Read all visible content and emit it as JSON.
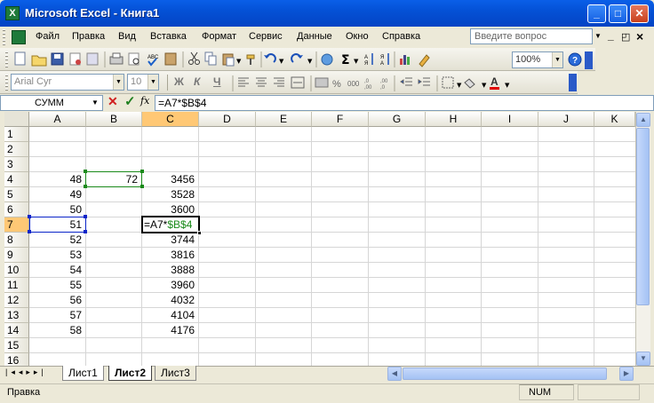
{
  "window": {
    "title": "Microsoft Excel - Книга1",
    "app_icon": "X",
    "min": "_",
    "max": "□",
    "close": "✕"
  },
  "menu": {
    "items": [
      "Файл",
      "Правка",
      "Вид",
      "Вставка",
      "Формат",
      "Сервис",
      "Данные",
      "Окно",
      "Справка"
    ],
    "help_placeholder": "Введите вопрос",
    "doc_min": "_",
    "doc_restore": "◰",
    "doc_close": "×"
  },
  "toolbar_standard": {
    "zoom": "100%",
    "sigma": "Σ"
  },
  "toolbar_format": {
    "font": "Arial Cyr",
    "size": "10",
    "bold": "Ж",
    "italic": "К",
    "underline": "Ч",
    "percent": "%",
    "thousands": "000"
  },
  "formula_bar": {
    "name_box": "СУММ",
    "cancel": "✕",
    "enter": "✓",
    "fx": "fx",
    "formula": "=A7*$B$4"
  },
  "grid": {
    "columns": [
      "A",
      "B",
      "C",
      "D",
      "E",
      "F",
      "G",
      "H",
      "I",
      "J",
      "K"
    ],
    "rows": [
      "1",
      "2",
      "3",
      "4",
      "5",
      "6",
      "7",
      "8",
      "9",
      "10",
      "11",
      "12",
      "13",
      "14",
      "15",
      "16"
    ],
    "colA": [
      "",
      "",
      "",
      "48",
      "49",
      "50",
      "51",
      "52",
      "53",
      "54",
      "55",
      "56",
      "57",
      "58",
      "",
      ""
    ],
    "colB": [
      "",
      "",
      "",
      "72",
      "",
      "",
      "",
      "",
      "",
      "",
      "",
      "",
      "",
      "",
      "",
      ""
    ],
    "colC": [
      "",
      "",
      "",
      "3456",
      "3528",
      "3600",
      "",
      "3744",
      "3816",
      "3888",
      "3960",
      "4032",
      "4104",
      "4176",
      "",
      ""
    ],
    "c7_formula_part1": "=A7*",
    "c7_formula_part2": "$B$4"
  },
  "sheets": {
    "tabs": [
      "Лист1",
      "Лист2",
      "Лист3"
    ],
    "active": "Лист2"
  },
  "status": {
    "mode": "Правка",
    "num": "NUM"
  },
  "colors": {
    "title_blue": "#0451D6",
    "ref_green": "#1A8A1A",
    "ref_blue": "#0A24C8",
    "header_selected": "#FFC875"
  }
}
